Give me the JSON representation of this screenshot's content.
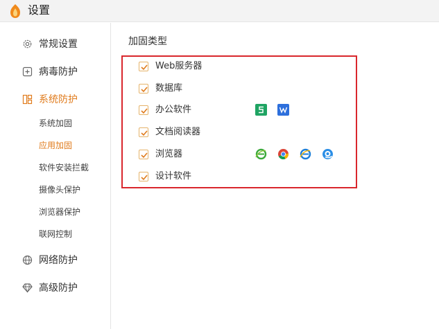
{
  "window": {
    "title": "设置"
  },
  "sidebar": {
    "items": [
      {
        "label": "常规设置",
        "icon": "gear-icon"
      },
      {
        "label": "病毒防护",
        "icon": "plus-square-icon"
      },
      {
        "label": "系统防护",
        "icon": "system-protect-icon",
        "active": true
      },
      {
        "label": "网络防护",
        "icon": "globe-icon"
      },
      {
        "label": "高级防护",
        "icon": "diamond-icon"
      }
    ],
    "sub_items": [
      {
        "label": "系统加固"
      },
      {
        "label": "应用加固",
        "active": true
      },
      {
        "label": "软件安装拦截"
      },
      {
        "label": "摄像头保护"
      },
      {
        "label": "浏览器保护"
      },
      {
        "label": "联网控制"
      }
    ]
  },
  "main": {
    "section_title": "加固类型",
    "options": [
      {
        "label": "Web服务器",
        "checked": true
      },
      {
        "label": "数据库",
        "checked": true
      },
      {
        "label": "办公软件",
        "checked": true,
        "apps": [
          "wps-spreadsheet-icon",
          "wps-writer-icon"
        ]
      },
      {
        "label": "文档阅读器",
        "checked": true
      },
      {
        "label": "浏览器",
        "checked": true,
        "apps": [
          "ie-green-icon",
          "chrome-icon",
          "ie-blue-icon",
          "qq-browser-icon"
        ]
      },
      {
        "label": "设计软件",
        "checked": true
      }
    ]
  },
  "colors": {
    "accent": "#e07b1c",
    "highlight_border": "#d9262c",
    "checkbox_border": "#e5b36a"
  }
}
